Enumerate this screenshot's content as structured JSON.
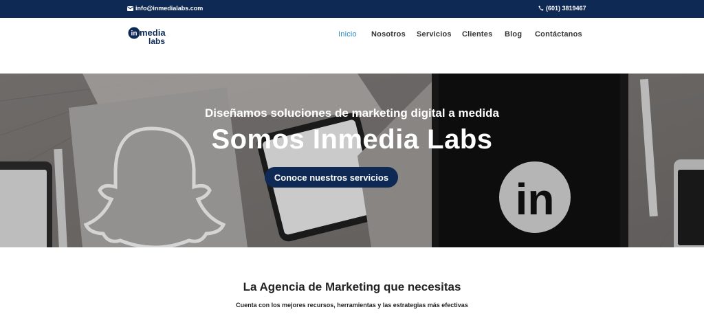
{
  "topbar": {
    "email": "info@inmedialabs.com",
    "phone": "(601) 3819467",
    "email_icon": "envelope-icon",
    "phone_icon": "phone-icon",
    "bg_color": "#0e2a54"
  },
  "logo": {
    "line1_prefix": "in",
    "line1_rest": "media",
    "line2": "labs"
  },
  "nav": {
    "items": [
      {
        "label": "Inicio",
        "active": true
      },
      {
        "label": "Nosotros",
        "active": false
      },
      {
        "label": "Servicios",
        "active": false
      },
      {
        "label": "Clientes",
        "active": false
      },
      {
        "label": "Blog",
        "active": false
      },
      {
        "label": "Contáctanos",
        "active": false
      }
    ],
    "active_color": "#2b8fc9"
  },
  "hero": {
    "subtitle": "Diseñamos soluciones de marketing digital a medida",
    "title": "Somos Inmedia Labs",
    "cta_label": "Conoce nuestros servicios",
    "cta_color": "#0e2a54",
    "tablet_logo_text": "in"
  },
  "intro": {
    "title": "La Agencia de Marketing que necesitas",
    "subtitle": "Cuenta con los mejores recursos, herramientas y las estrategias más efectivas"
  }
}
